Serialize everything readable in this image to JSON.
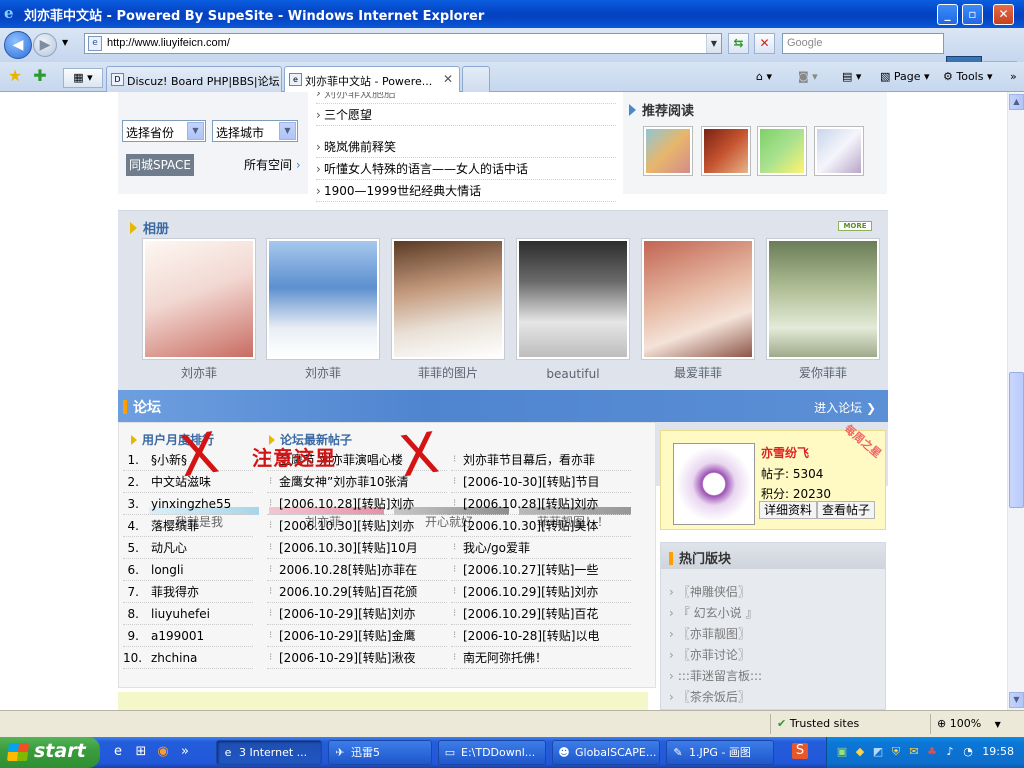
{
  "window": {
    "title": "刘亦菲中文站 - Powered By SupeSite - Windows Internet Explorer",
    "ie_icon": "e"
  },
  "address": {
    "url": "http://www.liuyifeicn.com/",
    "search_placeholder": "Google"
  },
  "tabs": [
    {
      "label": "Discuz! Board PHP|BBS|论坛 ..."
    },
    {
      "label": "刘亦菲中文站 - Powere..."
    }
  ],
  "toolbar": {
    "page_label": "Page",
    "tools_label": "Tools"
  },
  "top_left": {
    "province_select": "选择省份",
    "city_select": "选择城市",
    "tongcheng_button": "同城SPACE",
    "all_spaces_link": "所有空间"
  },
  "middle_links": [
    "刘亦菲双胞胎",
    "三个愿望",
    "晓岚佛前释笑",
    "听懂女人特殊的语言——女人的话中话",
    "1900—1999世纪经典大情话"
  ],
  "recommend": {
    "title": "推荐阅读"
  },
  "album": {
    "title": "相册",
    "more_label": "MORE",
    "captions": [
      "刘亦菲",
      "刘亦菲",
      "菲菲的图片",
      "beautiful",
      "最爱菲菲",
      "爱你菲菲"
    ]
  },
  "album_strip_captions": [
    "我就是我",
    "刘亦菲",
    "开心就好",
    "菲菲靓图！！"
  ],
  "forum": {
    "title": "论坛",
    "enter_label": "进入论坛",
    "monthly_ranking_title": "用户月度排行",
    "latest_posts_title": "论坛最新帖子",
    "ranking": [
      {
        "n": "1.",
        "name": "§小新§"
      },
      {
        "n": "2.",
        "name": "中文站滋味"
      },
      {
        "n": "3.",
        "name": "yinxingzhe55"
      },
      {
        "n": "4.",
        "name": "落樱缤菲"
      },
      {
        "n": "5.",
        "name": "动凡心"
      },
      {
        "n": "6.",
        "name": "longli"
      },
      {
        "n": "7.",
        "name": "菲我得亦"
      },
      {
        "n": "8.",
        "name": "liuyuhefei"
      },
      {
        "n": "9.",
        "name": "a199001"
      },
      {
        "n": "10.",
        "name": "zhchina"
      }
    ],
    "posts_col1": [
      "金鹰节 刘亦菲演唱心楼",
      "金鹰女神”刘亦菲10张清",
      "[2006.10.28][转贴]刘亦",
      "[2006.10.30][转贴]刘亦",
      "[2006.10.30][转贴]10月",
      "2006.10.28[转贴]亦菲在",
      "2006.10.29[转贴]百花颁",
      "[2006-10-29][转贴]刘亦",
      "[2006-10-29][转贴]金鹰",
      "[2006-10-29][转贴]湫夜"
    ],
    "posts_col2": [
      "刘亦菲节目幕后，看亦菲",
      "[2006-10-30][转贴]节目",
      "[2006.10.28][转贴]刘亦",
      "[2006.10.30][转贴]美体",
      "我心/go爱菲",
      "[2006.10.27][转贴]一些",
      "[2006.10.29][转贴]刘亦",
      "[2006.10.29][转贴]百花",
      "[2006-10-28][转贴]以电",
      "南无阿弥托佛！"
    ],
    "annotation": "注意这里",
    "x_marks": [
      "X",
      "X"
    ]
  },
  "star_user": {
    "name": "亦雪纷飞",
    "posts_label": "帖子: 5304",
    "points_label": "积分: 20230",
    "detail_button": "详细资料",
    "view_posts_button": "查看帖子",
    "badge": "每周之星"
  },
  "hot": {
    "title": "热门版块",
    "items": [
      "〖神雕侠侣〗",
      "『 幻玄小说 』",
      "〖亦菲靓图〗",
      "〖亦菲讨论〗",
      ":::菲迷留言板:::",
      "〖茶余饭后〗"
    ]
  },
  "statusbar": {
    "zone": "Trusted sites",
    "zoom": "100%"
  },
  "taskbar": {
    "start_label": "start",
    "items": [
      {
        "label": "3 Internet ...",
        "icon": "ie-icon"
      },
      {
        "label": "迅雷5",
        "icon": "thunder-icon"
      },
      {
        "label": "E:\\TDDownl...",
        "icon": "folder-icon"
      },
      {
        "label": "GlobalSCAPE...",
        "icon": "ftp-icon"
      },
      {
        "label": "1.JPG - 画图",
        "icon": "paint-icon"
      }
    ],
    "clock": "19:58"
  }
}
